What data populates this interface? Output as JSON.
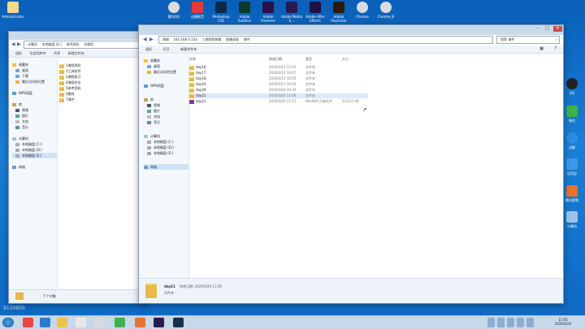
{
  "desktop": {
    "top_icons": [
      "腾讯QQ",
      "迅雷影音",
      "Photoshop CS6",
      "Adobe Audition",
      "Adobe Premiere",
      "Adobe Media E...",
      "Adobe After Effects",
      "Adobe Illustrator",
      "Chrome",
      "Chrome JS"
    ],
    "right_icons": [
      "QQ",
      "微信",
      "迅雷",
      "应用宝",
      "腾讯视频",
      "计算机"
    ],
    "left_icon": "Administrator",
    "watermark": "9130800"
  },
  "back_window": {
    "breadcrumb": [
      "计算机",
      "本地磁盘 (E:)",
      "讲师资料",
      "本课程"
    ],
    "toolbar": [
      "组织",
      "包含到库中",
      "共享",
      "新建文件夹"
    ],
    "nav": [
      "收藏夹",
      "桌面",
      "下载",
      "最近访问的位置",
      "WPS网盘",
      "库",
      "视频",
      "图片",
      "文档",
      "音乐",
      "计算机",
      "本地磁盘 (C:)",
      "本地磁盘 (D:)",
      "本地磁盘 (E:)",
      "网络"
    ],
    "files": [
      "1课程资料",
      "2工具软件",
      "3课程练习",
      "4课程作业",
      "5参考资料",
      "6素材",
      "7课件"
    ],
    "status_count": "7 个对象"
  },
  "front_window": {
    "breadcrumb": [
      "网络",
      "192.168.0.234",
      "三期视频剪辑",
      "直播录屏",
      "课件"
    ],
    "search_placeholder": "搜索 课件",
    "toolbar": [
      "组织",
      "打开",
      "新建文件夹"
    ],
    "nav": [
      "收藏夹",
      "桌面",
      "最近访问的位置",
      "WPS网盘",
      "库",
      "视频",
      "图片",
      "文档",
      "音乐",
      "计算机",
      "本地磁盘 (C:)",
      "本地磁盘 (D:)",
      "本地磁盘 (E:)",
      "网络"
    ],
    "columns": [
      "名称",
      "修改日期",
      "类型",
      "大小"
    ],
    "files": [
      {
        "name": "day16",
        "date": "2020/4/13 11:02",
        "type": "文件夹",
        "size": ""
      },
      {
        "name": "day17",
        "date": "2020/4/14 10:07",
        "type": "文件夹",
        "size": ""
      },
      {
        "name": "day18",
        "date": "2020/4/15 10:55",
        "type": "文件夹",
        "size": ""
      },
      {
        "name": "day19",
        "date": "2020/4/17 10:54",
        "type": "文件夹",
        "size": ""
      },
      {
        "name": "day20",
        "date": "2020/4/18 10:33",
        "type": "文件夹",
        "size": ""
      },
      {
        "name": "day21",
        "date": "2020/4/20 11:00",
        "type": "文件夹",
        "size": ""
      },
      {
        "name": "day21",
        "date": "2020/4/20 11:15",
        "type": "WinRAR 压缩文件",
        "size": "13,011 KB"
      }
    ],
    "status": {
      "name": "day21",
      "detail": "修改日期: 2020/4/20 11:00",
      "type": "文件夹"
    }
  },
  "taskbar": {
    "clock_time": "11:05",
    "clock_date": "2020/4/20"
  }
}
